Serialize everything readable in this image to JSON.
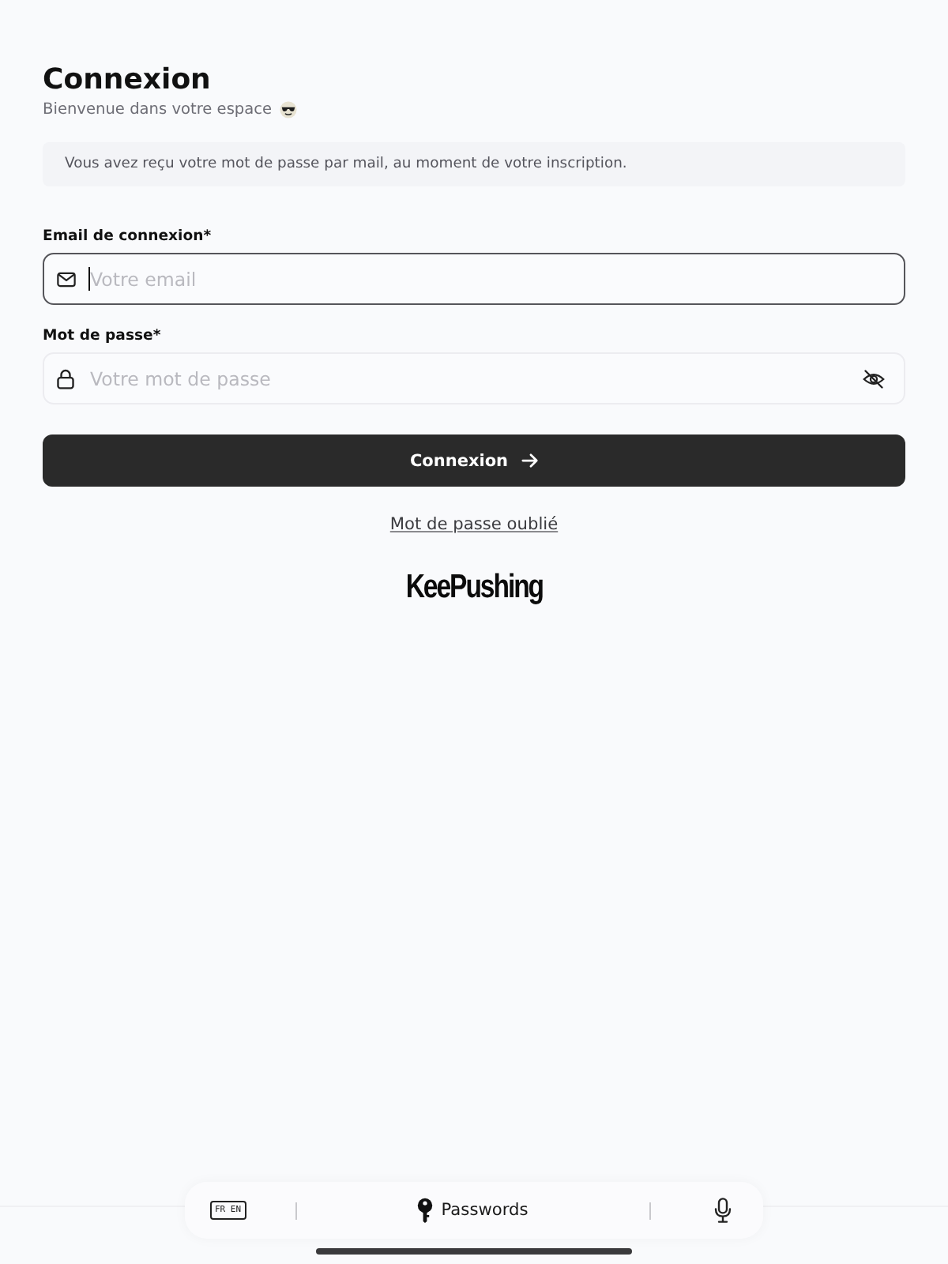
{
  "header": {
    "title": "Connexion",
    "subtitle": "Bienvenue dans votre espace"
  },
  "notice": "Vous avez reçu votre mot de passe par mail, au moment de votre inscription.",
  "fields": [
    {
      "kind": "email",
      "label": "Email de connexion*",
      "placeholder": "Votre email",
      "focused": true
    },
    {
      "kind": "password",
      "label": "Mot de passe*",
      "placeholder": "Votre mot de passe",
      "focused": false,
      "revealed": false
    }
  ],
  "submit": {
    "label": "Connexion"
  },
  "forgot_link": "Mot de passe oublié",
  "logo": "KeePushing",
  "keyboard_bar": {
    "language_key": "FR EN",
    "suggestion": "Passwords"
  }
}
